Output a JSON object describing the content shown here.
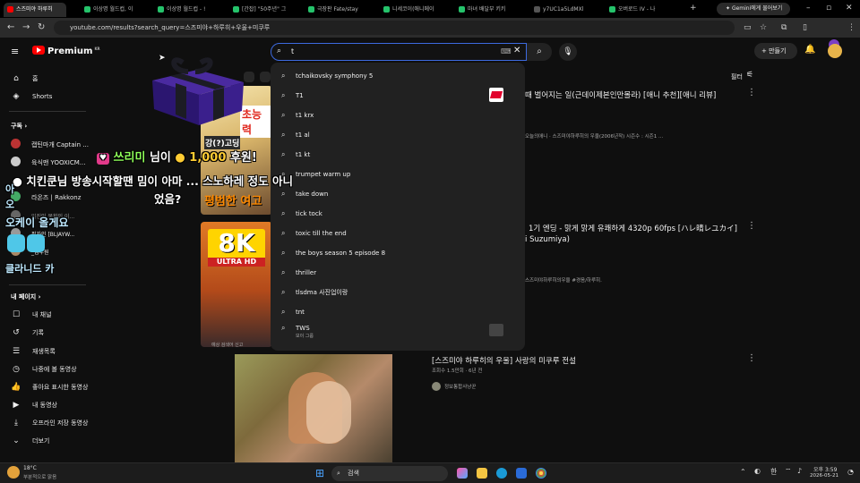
{
  "browser": {
    "tabs": [
      {
        "label": "스즈미야 하루히",
        "color": "#ff0000"
      },
      {
        "label": "이상명 월드컵, 이",
        "color": "#25c36b"
      },
      {
        "label": "이상명 월드컵 - !",
        "color": "#25c36b"
      },
      {
        "label": "[간잡] \"50주년\" 그",
        "color": "#25c36b"
      },
      {
        "label": "극장판 Fate/stay",
        "color": "#25c36b"
      },
      {
        "label": "니세코이(애니메이",
        "color": "#25c36b"
      },
      {
        "label": "마녀 배달부 키키",
        "color": "#25c36b"
      },
      {
        "label": "y7UC1a5LdMXl",
        "color": "#555555"
      },
      {
        "label": "오버로드 IV - 나",
        "color": "#25c36b"
      }
    ],
    "gemini_label": "Gemini에게 물어보기",
    "url": "youtube.com/results?search_query=스즈미야+하루히+우울+미쿠루"
  },
  "youtube": {
    "logo_text": "Premium",
    "logo_sup": "KR",
    "search_value": "t",
    "create_label": "만들기",
    "filter_label": "필터"
  },
  "sidebar": {
    "home": "홈",
    "shorts": "Shorts",
    "subs_header": "구독",
    "subs": [
      "캡틴마개 Captain ...",
      "육식맨 YOOXICM...",
      "라온즈 | Rakkonz",
      "일진인 몽환인 이...",
      "필자인 [BLJAYW...",
      "_김우원"
    ],
    "my_header": "내 페이지",
    "my": [
      "내 채널",
      "기록",
      "재생목록",
      "나중에 볼 동영상",
      "좋아요 표시한 동영상",
      "내 동영상",
      "오프라인 저장 동영상",
      "더보기"
    ]
  },
  "suggestions": [
    {
      "text": "tchaikovsky symphony 5"
    },
    {
      "text": "T1"
    },
    {
      "text": "t1 krx"
    },
    {
      "text": "t1 al"
    },
    {
      "text": "t1 kt"
    },
    {
      "text": "trumpet warm up"
    },
    {
      "text": "take down"
    },
    {
      "text": "tick tock"
    },
    {
      "text": "toxic till the end"
    },
    {
      "text": "the boys season 5 episode 8"
    },
    {
      "text": "thriller"
    },
    {
      "text": "tlsdma 사진업이랑"
    },
    {
      "text": "tnt"
    },
    {
      "text": "TWS",
      "sub": "보이 그룹"
    }
  ],
  "suggest_report": "예상 검색어 신고",
  "videos": [
    {
      "title": "때 벌어지는 일(근데이제본인만몰라) [애니 추천][애니 리뷰]",
      "meta": "오늘의애니 · 스즈미야하루히의 우울(2006년작) 시즌수 : 시즌1 ..."
    },
    {
      "title": "1기 엔딩 - 맑게 맑게 유쾌하게 4320p 60fps [ハレ晴レユカイ]",
      "title2": "i Suzumiya)",
      "meta": "스즈미야하루히의우울 #경음/하루히."
    },
    {
      "title": "[스즈미야 하루히의 우울] 사랑의 미쿠루 전설",
      "meta": "조회수 1.5만회 · 6년 전",
      "channel": "정보통합사냥꾼"
    }
  ],
  "thumb_texts": {
    "t1a": "초능력",
    "t1b": "평범한 여고",
    "t1c": "강(?)고딩",
    "t2a": "8K",
    "t2b": "ULTRA HD"
  },
  "overlay": {
    "donor": "쓰리미",
    "donor_suffix": "님이",
    "amount": "1,000",
    "amount_suffix": "후원!",
    "line1": "치킨쿤님 방송시작할땐 밈이 아마 ... 스노하레 정도 아니",
    "line2": "었음?",
    "side1": "아",
    "side2": "오",
    "side3": "오케이 올게요",
    "side4": "클라니드 카"
  },
  "taskbar": {
    "weather_temp": "18°C",
    "weather_desc": "부분적으로 맑음",
    "search_placeholder": "검색",
    "time": "오후 3:59",
    "date": "2026-05-21",
    "lang": "한"
  }
}
